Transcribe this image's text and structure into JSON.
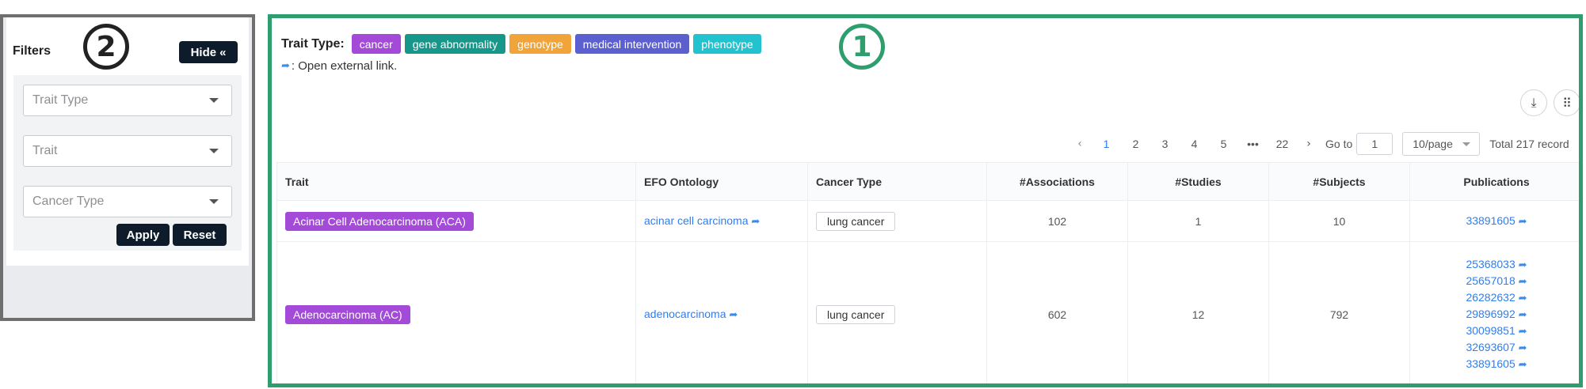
{
  "filters": {
    "title": "Filters",
    "hide_label": "Hide",
    "hide_icon": "«",
    "trait_type_placeholder": "Trait Type",
    "trait_placeholder": "Trait",
    "cancer_type_placeholder": "Cancer Type",
    "apply_label": "Apply",
    "reset_label": "Reset"
  },
  "callouts": {
    "main": "①",
    "filters": "②"
  },
  "legend": {
    "label": "Trait Type:",
    "types": [
      {
        "name": "cancer",
        "color": "#a34ad8"
      },
      {
        "name": "gene abnormality",
        "color": "#17978a"
      },
      {
        "name": "genotype",
        "color": "#f0a43a"
      },
      {
        "name": "medical intervention",
        "color": "#5b5fd0"
      },
      {
        "name": "phenotype",
        "color": "#22c3cf"
      }
    ],
    "external_link_note": ": Open external link."
  },
  "toolbar": {
    "download_icon": "download-icon",
    "columns_icon": "grid-icon"
  },
  "pagination": {
    "pages": [
      "1",
      "2",
      "3",
      "4",
      "5",
      "•••",
      "22"
    ],
    "current": "1",
    "goto_label": "Go to",
    "goto_value": "1",
    "page_size": "10/page",
    "total": "Total 217 record"
  },
  "table": {
    "headers": [
      "Trait",
      "EFO Ontology",
      "Cancer Type",
      "#Associations",
      "#Studies",
      "#Subjects",
      "Publications"
    ],
    "rows": [
      {
        "trait": "Acinar Cell Adenocarcinoma (ACA)",
        "efo": "acinar cell carcinoma",
        "cancer_type": "lung cancer",
        "associations": "102",
        "studies": "1",
        "subjects": "10",
        "publications": [
          "33891605"
        ]
      },
      {
        "trait": "Adenocarcinoma (AC)",
        "efo": "adenocarcinoma",
        "cancer_type": "lung cancer",
        "associations": "602",
        "studies": "12",
        "subjects": "792",
        "publications": [
          "25368033",
          "25657018",
          "26282632",
          "29896992",
          "30099851",
          "32693607",
          "33891605"
        ]
      }
    ]
  }
}
